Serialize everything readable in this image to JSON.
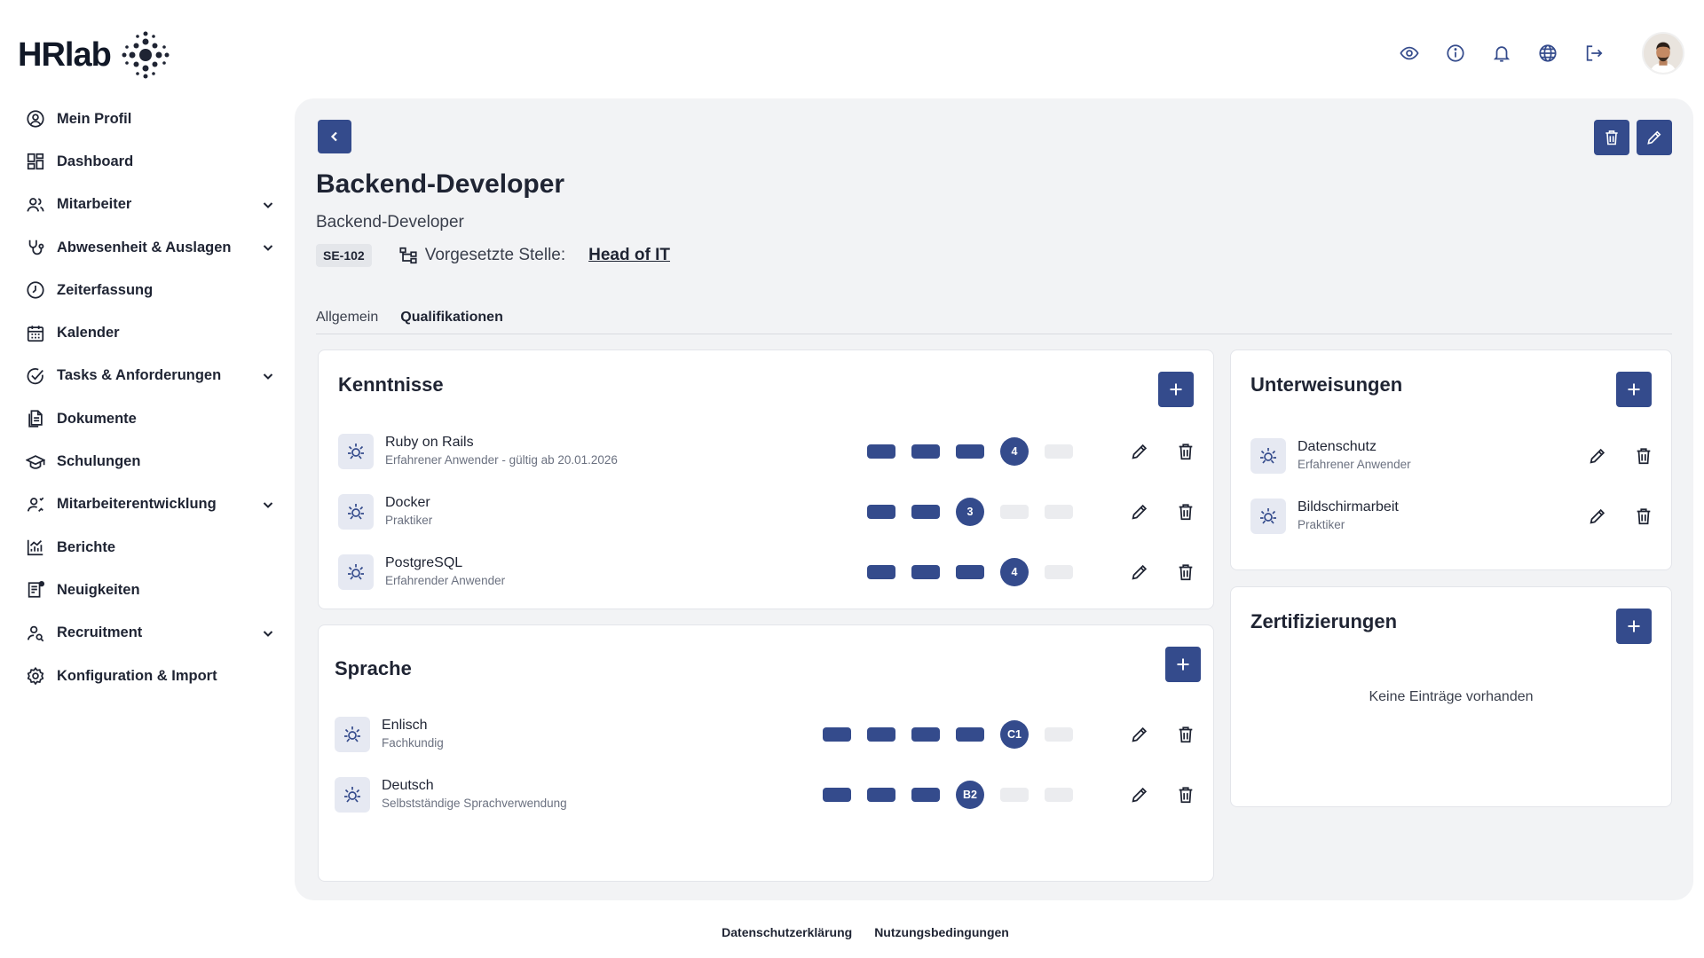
{
  "brand": {
    "name": "HRlab",
    "accent": "#344b8c",
    "text": "#1f2433",
    "panel_bg": "#f2f3f5",
    "empty_segment": "#ebecef"
  },
  "sidebar": {
    "items": [
      {
        "label": "Mein Profil",
        "icon": "user-circle-icon",
        "expandable": false
      },
      {
        "label": "Dashboard",
        "icon": "dashboard-icon",
        "expandable": false
      },
      {
        "label": "Mitarbeiter",
        "icon": "users-icon",
        "expandable": true
      },
      {
        "label": "Abwesenheit & Auslagen",
        "icon": "stethoscope-icon",
        "expandable": true
      },
      {
        "label": "Zeiterfassung",
        "icon": "clock-icon",
        "expandable": false
      },
      {
        "label": "Kalender",
        "icon": "calendar-icon",
        "expandable": false
      },
      {
        "label": "Tasks & Anforderungen",
        "icon": "check-circle-icon",
        "expandable": true
      },
      {
        "label": "Dokumente",
        "icon": "documents-icon",
        "expandable": false
      },
      {
        "label": "Schulungen",
        "icon": "graduation-cap-icon",
        "expandable": false
      },
      {
        "label": "Mitarbeiterentwicklung",
        "icon": "user-growth-icon",
        "expandable": true
      },
      {
        "label": "Berichte",
        "icon": "chart-icon",
        "expandable": false
      },
      {
        "label": "Neuigkeiten",
        "icon": "news-icon",
        "expandable": false
      },
      {
        "label": "Recruitment",
        "icon": "user-search-icon",
        "expandable": true
      },
      {
        "label": "Konfiguration & Import",
        "icon": "settings-icon",
        "expandable": false
      }
    ]
  },
  "topbar": {
    "icons": [
      "eye-icon",
      "info-icon",
      "bell-icon",
      "globe-icon",
      "logout-icon"
    ]
  },
  "position": {
    "title": "Backend-Developer",
    "subtitle": "Backend-Developer",
    "code": "SE-102",
    "supervisor_label": "Vorgesetzte Stelle:",
    "supervisor_value": "Head of IT"
  },
  "tabs": [
    {
      "label": "Allgemein",
      "active": false
    },
    {
      "label": "Qualifikationen",
      "active": true
    }
  ],
  "kenntnisse": {
    "title": "Kenntnisse",
    "items": [
      {
        "name": "Ruby on Rails",
        "desc": "Erfahrener Anwender - gültig ab 20.01.2026",
        "level": 4,
        "max": 5,
        "marker": "4"
      },
      {
        "name": "Docker",
        "desc": "Praktiker",
        "level": 3,
        "max": 5,
        "marker": "3"
      },
      {
        "name": "PostgreSQL",
        "desc": "Erfahrender Anwender",
        "level": 4,
        "max": 5,
        "marker": "4"
      }
    ]
  },
  "sprache": {
    "title": "Sprache",
    "items": [
      {
        "name": "Enlisch",
        "desc": "Fachkundig",
        "level": 5,
        "max": 6,
        "marker": "C1"
      },
      {
        "name": "Deutsch",
        "desc": "Selbstständige Sprachverwendung",
        "level": 4,
        "max": 6,
        "marker": "B2"
      }
    ]
  },
  "unterweisungen": {
    "title": "Unterweisungen",
    "items": [
      {
        "name": "Datenschutz",
        "desc": "Erfahrener Anwender"
      },
      {
        "name": "Bildschirmarbeit",
        "desc": "Praktiker"
      }
    ]
  },
  "zertifizierungen": {
    "title": "Zertifizierungen",
    "empty_text": "Keine Einträge vorhanden"
  },
  "footer": {
    "privacy": "Datenschutzerklärung",
    "terms": "Nutzungsbedingungen"
  }
}
